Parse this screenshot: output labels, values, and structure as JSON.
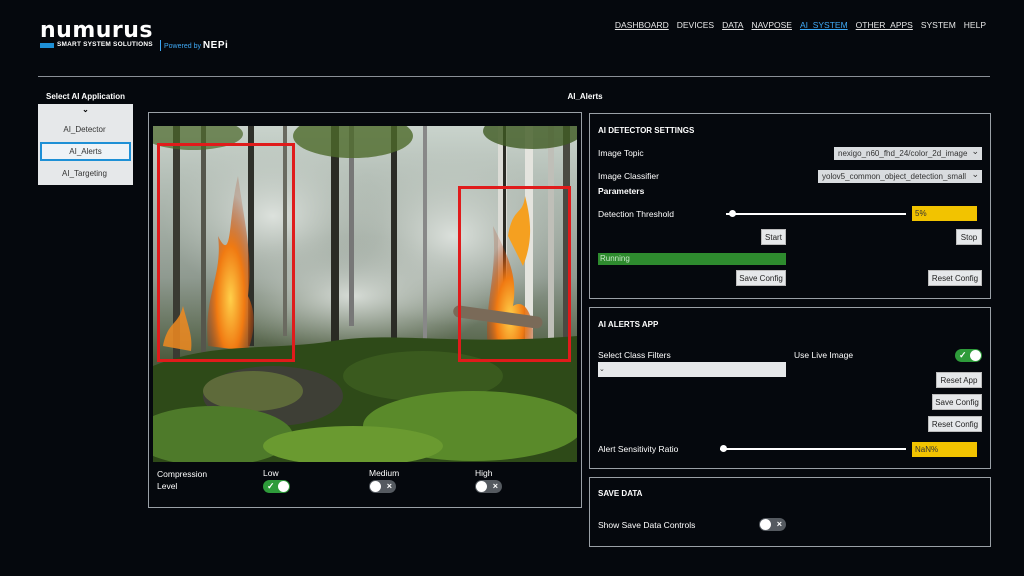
{
  "brand": {
    "name": "numurus",
    "tagline": "SMART SYSTEM SOLUTIONS",
    "powered_prefix": "Powered by",
    "powered_brand": "NEPi"
  },
  "nav": {
    "items": [
      "DASHBOARD",
      "DEVICES",
      "DATA",
      "NAVPOSE",
      "AI_SYSTEM",
      "OTHER_APPS",
      "SYSTEM",
      "HELP"
    ],
    "active": "AI_SYSTEM"
  },
  "app_selector": {
    "title": "Select AI Application",
    "chevron": "⌄",
    "items": [
      "AI_Detector",
      "AI_Alerts",
      "AI_Targeting"
    ],
    "selected": "AI_Alerts"
  },
  "page_title": "AI_Alerts",
  "image_panel": {
    "compression_label_line1": "Compression",
    "compression_label_line2": "Level",
    "levels": [
      {
        "label": "Low",
        "on": true
      },
      {
        "label": "Medium",
        "on": false
      },
      {
        "label": "High",
        "on": false
      }
    ]
  },
  "detector_settings": {
    "title": "AI DETECTOR SETTINGS",
    "image_topic_label": "Image Topic",
    "image_topic_value": "nexigo_n60_fhd_24/color_2d_image",
    "image_classifier_label": "Image Classifier",
    "image_classifier_value": "yolov5_common_object_detection_small",
    "parameters_label": "Parameters",
    "threshold_label": "Detection Threshold",
    "threshold_value": "5%",
    "start_label": "Start",
    "stop_label": "Stop",
    "status_text": "Running",
    "save_config_label": "Save Config",
    "reset_config_label": "Reset Config"
  },
  "alerts_app": {
    "title": "AI ALERTS APP",
    "class_filters_label": "Select Class Filters",
    "use_live_label": "Use Live Image",
    "use_live_on": true,
    "reset_app_label": "Reset App",
    "save_config_label": "Save Config",
    "reset_config_label": "Reset Config",
    "sensitivity_label": "Alert Sensitivity Ratio",
    "sensitivity_value": "NaN%"
  },
  "save_data": {
    "title": "SAVE DATA",
    "show_controls_label": "Show Save Data Controls",
    "show_controls_on": false
  },
  "colors": {
    "background": "#05080d",
    "accent_blue": "#1e90d6",
    "toggle_on": "#2e9b3a",
    "value_box": "#f2c300",
    "bbox": "#e01b1b"
  }
}
